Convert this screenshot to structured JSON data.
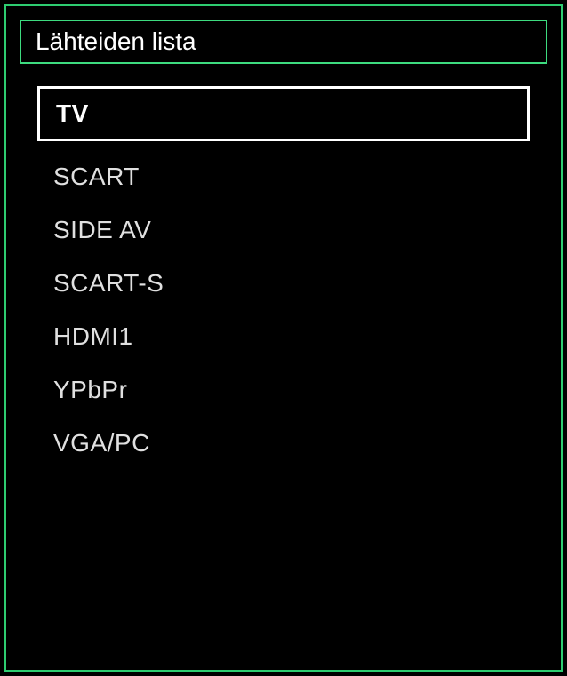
{
  "title": "Lähteiden lista",
  "sources": [
    {
      "label": "TV",
      "selected": true
    },
    {
      "label": "SCART",
      "selected": false
    },
    {
      "label": "SIDE AV",
      "selected": false
    },
    {
      "label": "SCART-S",
      "selected": false
    },
    {
      "label": "HDMI1",
      "selected": false
    },
    {
      "label": "YPbPr",
      "selected": false
    },
    {
      "label": "VGA/PC",
      "selected": false
    }
  ]
}
